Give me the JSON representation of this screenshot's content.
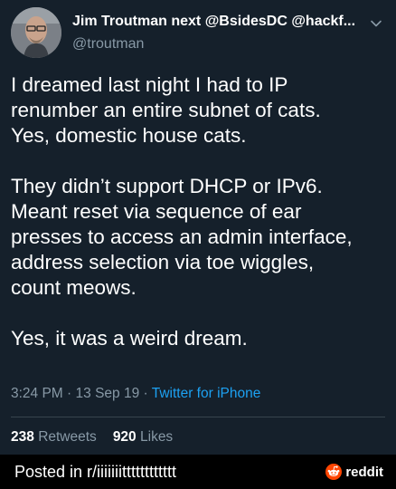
{
  "tweet": {
    "display_name": "Jim Troutman next @BsidesDC @hackf...",
    "handle": "@troutman",
    "paragraphs": [
      "I dreamed last night I had to IP\nrenumber an entire subnet of cats.\nYes, domestic house cats.",
      "They didn’t support DHCP or IPv6.\nMeant reset via sequence of ear\npresses to access an admin interface,\naddress selection via toe wiggles,\ncount meows.",
      "Yes, it was a weird dream."
    ],
    "time": "3:24 PM",
    "date": "13 Sep 19",
    "separator": "·",
    "source": "Twitter for iPhone",
    "retweets_count": "238",
    "retweets_label": "Retweets",
    "likes_count": "920",
    "likes_label": "Likes"
  },
  "footer": {
    "posted_in": "Posted in r/iiiiiiitttttttttttt",
    "brand": "reddit"
  },
  "icons": {
    "caret": "chevron-down-icon",
    "avatar": "avatar",
    "brand_logo": "reddit-snoo-icon"
  },
  "colors": {
    "background": "#15202b",
    "secondary_text": "#8899a6",
    "link": "#1da1f2",
    "divider": "#38444d",
    "reddit_orange": "#ff4500"
  }
}
